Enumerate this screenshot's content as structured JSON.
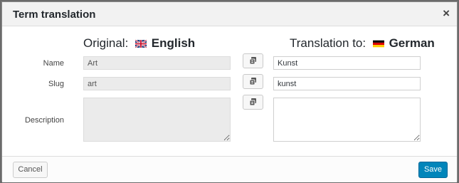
{
  "dialog": {
    "title": "Term translation",
    "close_symbol": "×"
  },
  "original": {
    "heading_prefix": "Original:",
    "language": "English",
    "flag": "uk-flag-icon"
  },
  "translation": {
    "heading_prefix": "Translation to:",
    "language": "German",
    "flag": "germany-flag-icon"
  },
  "fields": {
    "name_label": "Name",
    "slug_label": "Slug",
    "description_label": "Description",
    "original_name": "Art",
    "original_slug": "art",
    "original_description": "",
    "translated_name": "Kunst",
    "translated_slug": "kunst",
    "translated_description": ""
  },
  "footer": {
    "cancel_label": "Cancel",
    "save_label": "Save"
  },
  "colors": {
    "primary_button": "#0085ba",
    "readonly_field": "#ebebeb"
  }
}
